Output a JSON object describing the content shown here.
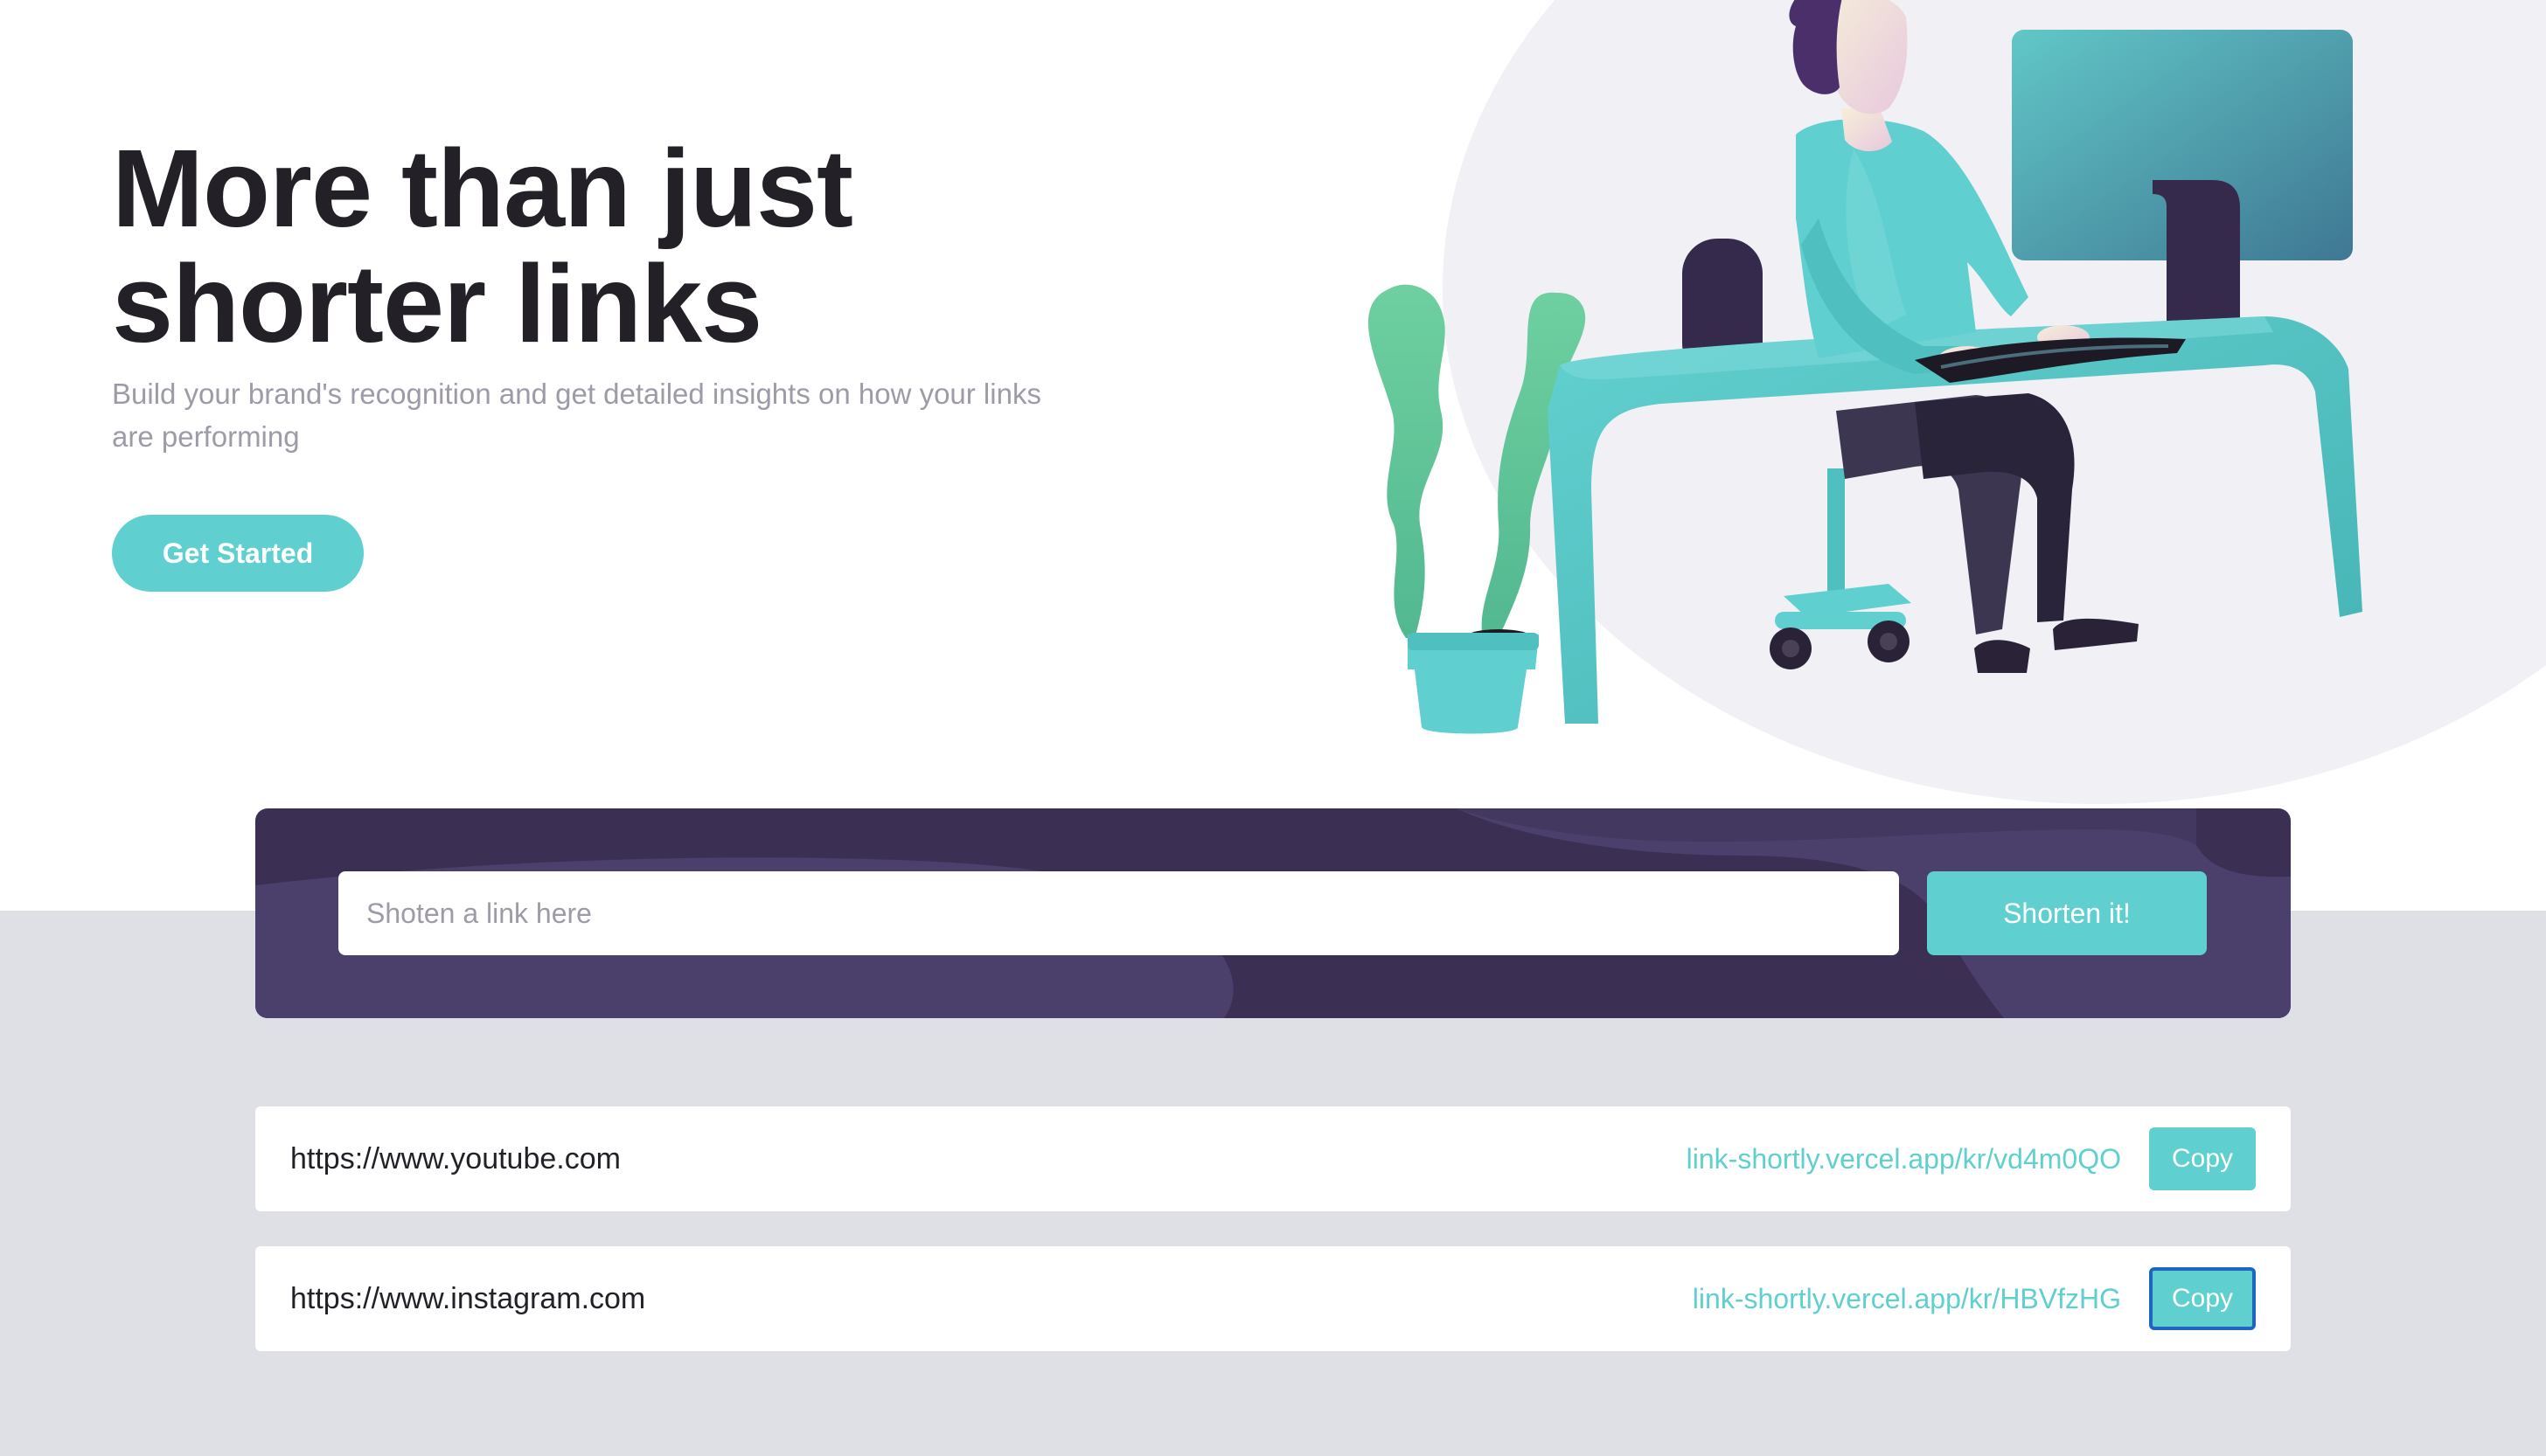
{
  "hero": {
    "title_line1": "More than just",
    "title_line2": "shorter links",
    "subtitle_line1": "Build your brand's recognition and get detailed insights on how your links",
    "subtitle_line2": "are performing",
    "cta_label": "Get Started"
  },
  "shortener": {
    "input_placeholder": "Shoten a link here",
    "input_value": "",
    "button_label": "Shorten it!"
  },
  "results": [
    {
      "original": "https://www.youtube.com",
      "short": "link-shortly.vercel.app/kr/vd4m0QO",
      "copy_label": "Copy",
      "copy_focused": false
    },
    {
      "original": "https://www.instagram.com",
      "short": "link-shortly.vercel.app/kr/HBVfzHG",
      "copy_label": "Copy",
      "copy_focused": true
    }
  ],
  "colors": {
    "primary_cyan": "#5fcfcf",
    "dark_violet": "#3b3054",
    "panel_wave": "#4b3f6b",
    "heading_text": "#232127",
    "muted_text": "#9e9aa7",
    "page_gray": "#dfdfe6",
    "focus_ring": "#1f66c1"
  },
  "icons": {
    "illustration": "person-working-at-desk-illustration"
  }
}
